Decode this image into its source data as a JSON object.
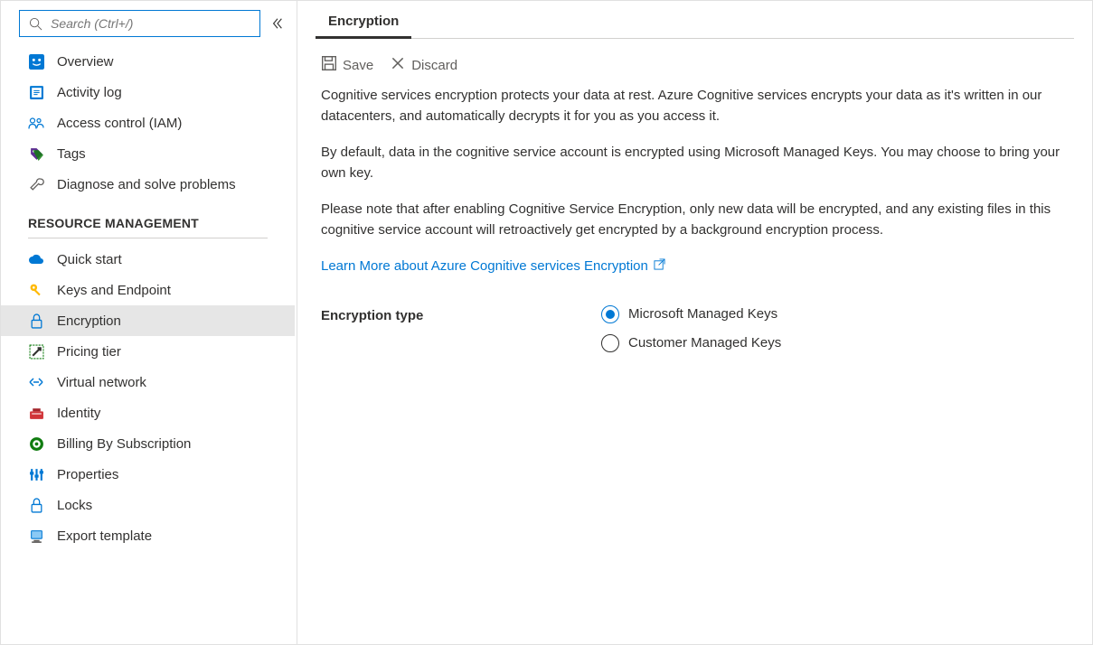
{
  "search": {
    "placeholder": "Search (Ctrl+/)"
  },
  "sidebar": {
    "items": [
      {
        "label": "Overview"
      },
      {
        "label": "Activity log"
      },
      {
        "label": "Access control (IAM)"
      },
      {
        "label": "Tags"
      },
      {
        "label": "Diagnose and solve problems"
      }
    ],
    "section_rm": "RESOURCE MANAGEMENT",
    "rm_items": [
      {
        "label": "Quick start"
      },
      {
        "label": "Keys and Endpoint"
      },
      {
        "label": "Encryption"
      },
      {
        "label": "Pricing tier"
      },
      {
        "label": "Virtual network"
      },
      {
        "label": "Identity"
      },
      {
        "label": "Billing By Subscription"
      },
      {
        "label": "Properties"
      },
      {
        "label": "Locks"
      },
      {
        "label": "Export template"
      }
    ]
  },
  "main": {
    "tab": "Encryption",
    "save": "Save",
    "discard": "Discard",
    "para1": "Cognitive services encryption protects your data at rest. Azure Cognitive services encrypts your data as it's written in our datacenters, and automatically decrypts it for you as you access it.",
    "para2": "By default, data in the cognitive service account is encrypted using Microsoft Managed Keys. You may choose to bring your own key.",
    "para3": "Please note that after enabling Cognitive Service Encryption, only new data will be encrypted, and any existing files in this cognitive service account will retroactively get encrypted by a background encryption process.",
    "learn_more": "Learn More about Azure Cognitive services Encryption",
    "field_label": "Encryption type",
    "radio1": "Microsoft Managed Keys",
    "radio2": "Customer Managed Keys"
  }
}
